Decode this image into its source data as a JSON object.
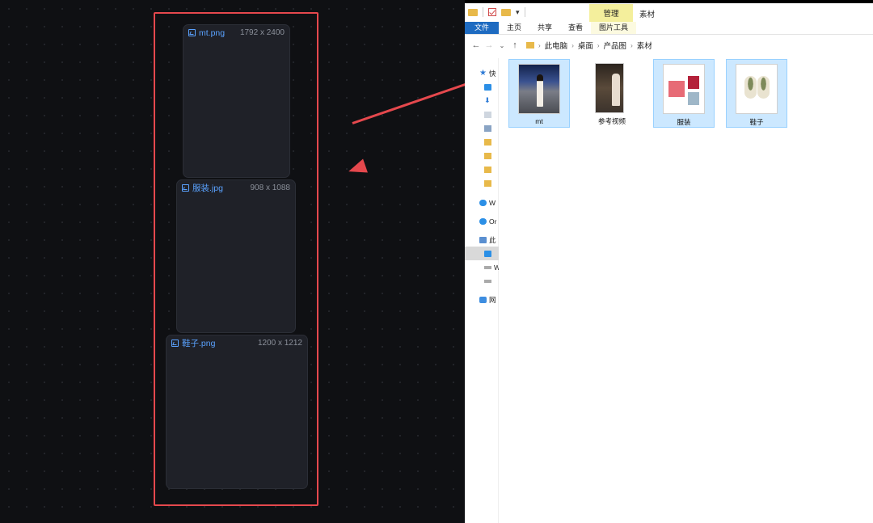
{
  "canvas": {
    "nodes": [
      {
        "name": "mt.png",
        "dims": "1792 x 2400"
      },
      {
        "name": "服装.jpg",
        "dims": "908 x 1088"
      },
      {
        "name": "鞋子.png",
        "dims": "1200 x 1212"
      }
    ],
    "accent_color": "#e5484d",
    "title_color": "#5aa2ff"
  },
  "explorer": {
    "ribbon": {
      "manage_tab": "管理",
      "window_title": "素材",
      "tabs": [
        "文件",
        "主页",
        "共享",
        "查看",
        "图片工具"
      ]
    },
    "breadcrumb": [
      "此电脑",
      "桌面",
      "产品图",
      "素材"
    ],
    "nav_pane": [
      {
        "label": "快",
        "icon": "star-icon"
      },
      {
        "label": "",
        "icon": "monitor-icon"
      },
      {
        "label": "",
        "icon": "download-icon"
      },
      {
        "label": "",
        "icon": "document-icon"
      },
      {
        "label": "",
        "icon": "picture-icon"
      },
      {
        "label": "",
        "icon": "folder-icon"
      },
      {
        "label": "",
        "icon": "folder-icon"
      },
      {
        "label": "",
        "icon": "folder-icon"
      },
      {
        "label": "",
        "icon": "folder-icon"
      },
      {
        "label": "W",
        "icon": "cloud-icon"
      },
      {
        "label": "Or",
        "icon": "cloud-icon"
      },
      {
        "label": "此",
        "icon": "computer-icon"
      },
      {
        "label": "",
        "icon": "monitor-icon"
      },
      {
        "label": "W",
        "icon": "drive-icon"
      },
      {
        "label": "",
        "icon": "drive-icon"
      },
      {
        "label": "网",
        "icon": "network-icon"
      }
    ],
    "files": [
      {
        "label": "mt",
        "selected": true
      },
      {
        "label": "参考视频",
        "selected": false
      },
      {
        "label": "服装",
        "selected": true
      },
      {
        "label": "鞋子",
        "selected": true
      }
    ]
  }
}
